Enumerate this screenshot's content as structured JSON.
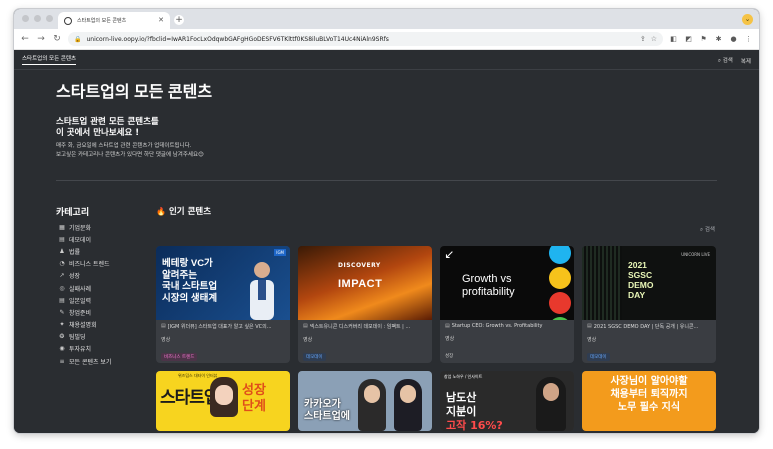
{
  "browser": {
    "tab_title": "스타트업의 모든 콘텐츠",
    "url": "unicorn-live.oopy.io/?fbclid=IwAR1FocLxOdqwbGAFgHGoDESFV6TKlttf0KS8iluBLVoT14Uc4NiAln9SRfs"
  },
  "site": {
    "breadcrumb": "스타트업의 모든 콘텐츠",
    "search_label": "검색",
    "duplicate_label": "복제",
    "title": "스타트업의 모든 콘텐츠",
    "intro_heading": "스타트업 관련 모든 콘텐츠를\n이 곳에서 만나보세요 !",
    "intro_desc_1": "매주 화, 금요일에 스타트업 관련 콘텐츠가 업데이트됩니다.",
    "intro_desc_2": "보고싶은 카테고리나 콘텐츠가 있다면 하단 댓글에 남겨주세요😊"
  },
  "categories": {
    "title": "카테고리",
    "items": [
      {
        "icon": "building-icon",
        "glyph": "▦",
        "label": "기업문화"
      },
      {
        "icon": "calendar-icon",
        "glyph": "▤",
        "label": "데모데이"
      },
      {
        "icon": "people-icon",
        "glyph": "♟",
        "label": "법률"
      },
      {
        "icon": "chart-icon",
        "glyph": "◔",
        "label": "비즈니스 트렌드"
      },
      {
        "icon": "growth-icon",
        "glyph": "↗",
        "label": "성장"
      },
      {
        "icon": "case-icon",
        "glyph": "◎",
        "label": "실패사례"
      },
      {
        "icon": "document-icon",
        "glyph": "▤",
        "label": "일본일력"
      },
      {
        "icon": "startup-icon",
        "glyph": "✎",
        "label": "창업준비"
      },
      {
        "icon": "handshake-icon",
        "glyph": "✦",
        "label": "채용설명회"
      },
      {
        "icon": "team-icon",
        "glyph": "❂",
        "label": "팀빌딩"
      },
      {
        "icon": "money-icon",
        "glyph": "◉",
        "label": "투자유치"
      },
      {
        "icon": "list-icon",
        "glyph": "≡",
        "label": "모든 콘텐츠 보기"
      }
    ]
  },
  "popular": {
    "title": "인기 콘텐츠",
    "search_label": "검색",
    "cards": [
      {
        "title": "[IGM 위더뷰] 스타트업 대표가 알고 싶은 VC의...",
        "type": "영상",
        "tag": "비즈니스 트렌드",
        "thumb_text": "베테랑 VC가\n알려주는\n국내 스타트업\n시장의 생태계",
        "badge": "IGM"
      },
      {
        "title": "넥스트유니콘 디스커버리 데모데이 : 임팩트 | ...",
        "type": "영상",
        "tag": "데모데이",
        "thumb_text_1": "DISCOVERY",
        "thumb_text_2": "IMPACT"
      },
      {
        "title": "Startup CEO: Growth vs. Profitability",
        "type": "영상",
        "tag": "성장",
        "thumb_text": "Growth vs\nprofitability"
      },
      {
        "title": "2021 SGSC DEMO DAY | 단독 공개 | 유니콘...",
        "type": "영상",
        "tag": "데모데이",
        "thumb_text": "2021\nSGSC\nDEMO\nDAY",
        "logo": "UNICORN LIVE"
      },
      {
        "thumb_text_1": "스타트업",
        "thumb_text_2": "성장\n단계",
        "top_text": "위즈덤스 대타이 인터뷰"
      },
      {
        "thumb_text": "카카오가\n스타트업에"
      },
      {
        "header": "창업 노하우 / 인사이트",
        "thumb_text_1": "남도산\n지분이",
        "thumb_text_2": "고작 16%?"
      },
      {
        "thumb_text": "사장님이 알아야할\n채용부터 퇴직까지\n노무 필수 지식"
      }
    ]
  },
  "colors": {
    "accent_pink": "#ff7ad9",
    "accent_blue": "#67a9ff",
    "page_bg": "#2a2d31"
  }
}
